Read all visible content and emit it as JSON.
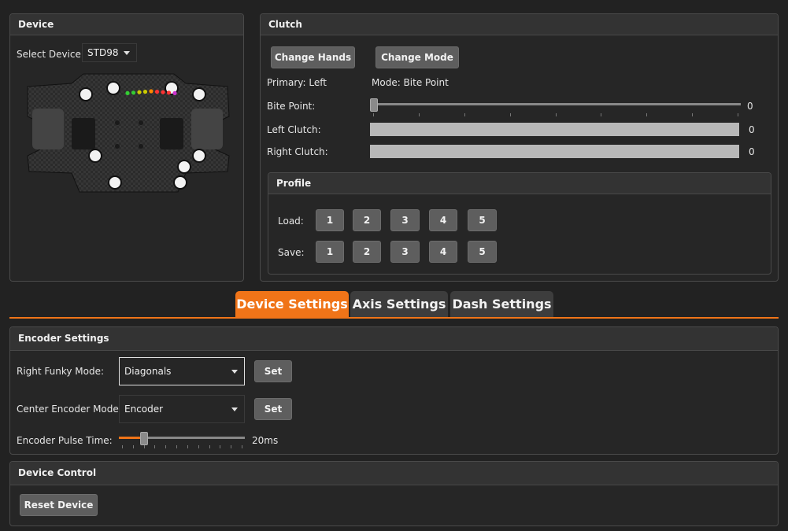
{
  "device_panel": {
    "title": "Device",
    "select_label": "Select Device:",
    "select_value": "STD98"
  },
  "clutch_panel": {
    "title": "Clutch",
    "change_hands_label": "Change Hands",
    "change_mode_label": "Change Mode",
    "primary_text": "Primary: Left",
    "mode_text": "Mode: Bite Point",
    "bite_point_label": "Bite Point:",
    "bite_point_value": "0",
    "bite_point_level": 0,
    "left_clutch_label": "Left Clutch:",
    "left_clutch_value": "0",
    "right_clutch_label": "Right Clutch:",
    "right_clutch_value": "0"
  },
  "profile_panel": {
    "title": "Profile",
    "load_label": "Load:",
    "save_label": "Save:",
    "slots": [
      "1",
      "2",
      "3",
      "4",
      "5"
    ]
  },
  "tabs": [
    {
      "label": "Device Settings",
      "active": true
    },
    {
      "label": "Axis Settings",
      "active": false
    },
    {
      "label": "Dash Settings",
      "active": false
    }
  ],
  "encoder_panel": {
    "title": "Encoder Settings",
    "right_funky_label": "Right Funky Mode:",
    "right_funky_value": "Diagonals",
    "center_encoder_label": "Center Encoder Mode:",
    "center_encoder_value": "Encoder",
    "set_label": "Set",
    "pulse_label": "Encoder Pulse Time:",
    "pulse_value": "20ms",
    "pulse_level": 0.18
  },
  "control_panel": {
    "title": "Device Control",
    "reset_label": "Reset Device"
  },
  "colors": {
    "accent": "#f07418",
    "panel_bg": "#262626",
    "button": "#5e5e5e",
    "bar": "#b8b8b8",
    "led_colors": [
      "#33cc33",
      "#33cc33",
      "#cccc00",
      "#cccc00",
      "#ff8800",
      "#ff3333",
      "#ff3333",
      "#ff3333",
      "#cc33cc"
    ]
  }
}
